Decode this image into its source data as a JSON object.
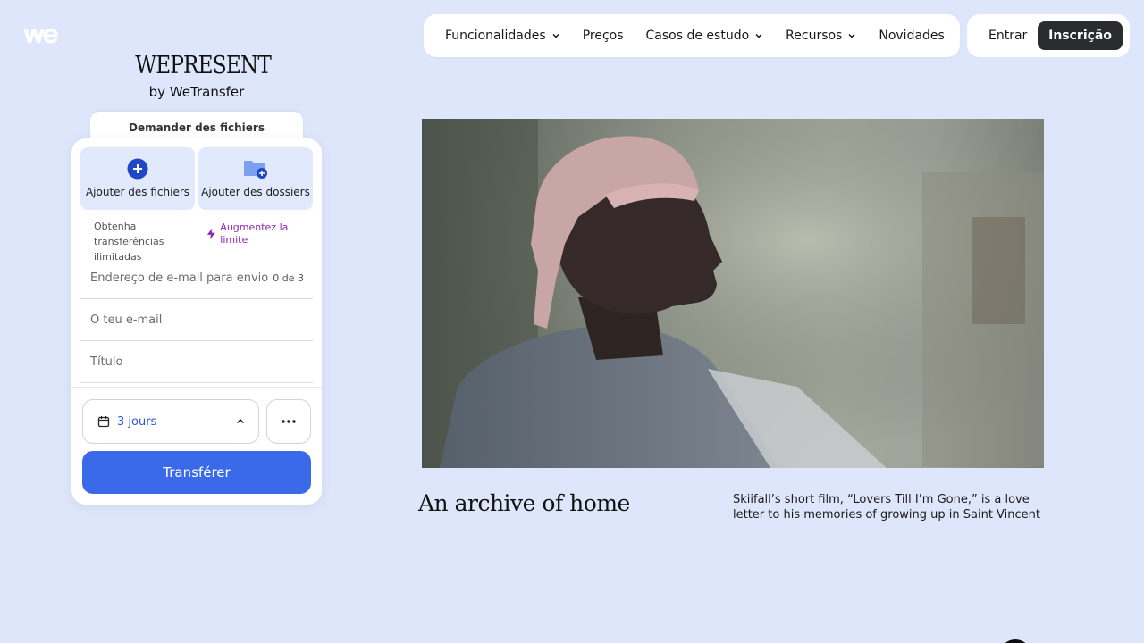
{
  "nav": {
    "items": [
      {
        "label": "Funcionalidades",
        "has_dropdown": true
      },
      {
        "label": "Preços",
        "has_dropdown": false
      },
      {
        "label": "Casos de estudo",
        "has_dropdown": true
      },
      {
        "label": "Recursos",
        "has_dropdown": true
      },
      {
        "label": "Novidades",
        "has_dropdown": false
      }
    ],
    "login": "Entrar",
    "signup": "Inscrição"
  },
  "brand": {
    "title": "WEPRESENT",
    "subtitle": "by WeTransfer"
  },
  "upload": {
    "request_tab": "Demander des fichiers",
    "add_files": "Ajouter des fichiers",
    "add_folders": "Ajouter des dossiers",
    "limit_text": "Obtenha transferências ilimitadas",
    "boost": "Augmentez la limite",
    "recipient_placeholder": "Endereço de e-mail para envio",
    "recipient_count": "0 de 3",
    "email_placeholder": "O teu e-mail",
    "title_placeholder": "Título",
    "expiry": "3 jours",
    "transfer": "Transférer"
  },
  "hero": {
    "title": "An archive of home",
    "description": "Skiifall’s short film, “Lovers Till I’m Gone,” is a love letter to his memories of growing up in Saint Vincent"
  },
  "colors": {
    "background": "#dde6fb",
    "primary": "#3a69ea",
    "boost": "#8b27b5",
    "signup_bg": "#2b2c2f"
  },
  "icons": [
    "wetransfer-logo-icon",
    "chevron-down-icon",
    "plus-circle-icon",
    "folder-plus-icon",
    "lightning-icon",
    "calendar-icon",
    "chevron-up-icon",
    "more-icon"
  ]
}
